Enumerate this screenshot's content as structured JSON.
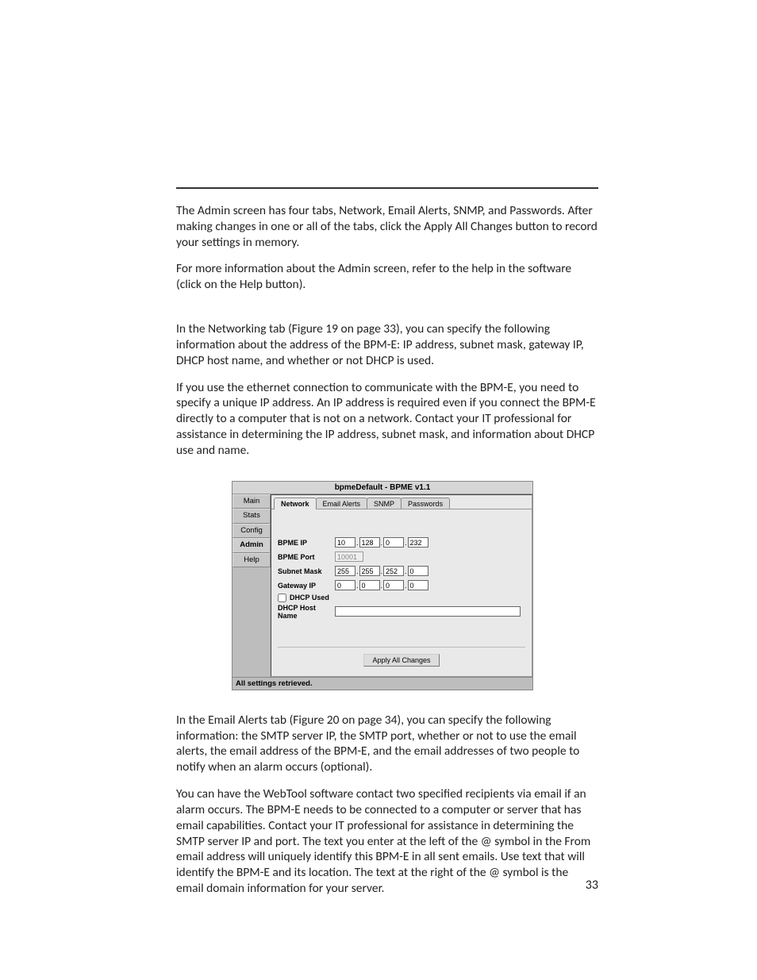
{
  "paragraphs": {
    "p1": "The Admin screen has four tabs, Network, Email Alerts, SNMP, and Passwords. After making changes in one or all of the tabs, click the Apply All Changes button to record your settings in memory.",
    "p2": "For more information about the Admin screen, refer to the help in the software (click on the Help button).",
    "p3": "In the Networking tab (Figure 19 on page 33), you can specify the following information about the address of the BPM-E: IP address, subnet mask, gateway IP, DHCP host name, and whether or not DHCP is used.",
    "p4": "If you use the ethernet connection to communicate with the BPM-E, you need to specify a unique IP address. An IP address is required even if you connect the BPM-E directly to a computer that is not on a network. Contact your IT professional for assistance in determining the IP address, subnet mask, and information about DHCP use and name.",
    "p5": "In the Email Alerts tab (Figure 20 on page 34), you can specify the following information: the SMTP server IP, the SMTP port, whether or not to use the email alerts, the email address of the BPM-E, and the email addresses of two people to notify when an alarm occurs (optional).",
    "p6": "You can have the WebTool software contact two specified recipients via email if an alarm occurs. The BPM-E needs to be connected to a computer or server that has email capabilities. Contact your IT professional for assistance in determining the SMTP server IP and port. The text you enter at the left of the @ symbol in the From email address will uniquely identify this BPM-E in all sent emails. Use text that will identify the BPM-E and its location. The text at the right of the @ symbol is the email domain information for your server."
  },
  "app": {
    "title": "bpmeDefault - BPME v1.1",
    "sidebar": {
      "main": "Main",
      "stats": "Stats",
      "config": "Config",
      "admin": "Admin",
      "help": "Help"
    },
    "tabs": {
      "network": "Network",
      "email": "Email Alerts",
      "snmp": "SNMP",
      "passwords": "Passwords"
    },
    "form": {
      "bpme_ip_label": "BPME IP",
      "bpme_port_label": "BPME Port",
      "subnet_label": "Subnet Mask",
      "gateway_label": "Gateway IP",
      "dhcp_used_label": "DHCP Used",
      "dhcp_host_label": "DHCP Host Name",
      "bpme_ip": [
        "10",
        "128",
        "0",
        "232"
      ],
      "bpme_port": "10001",
      "subnet": [
        "255",
        "255",
        "252",
        "0"
      ],
      "gateway": [
        "0",
        "0",
        "0",
        "0"
      ]
    },
    "apply_label": "Apply All Changes",
    "status": "All settings retrieved."
  },
  "page_number": "33"
}
